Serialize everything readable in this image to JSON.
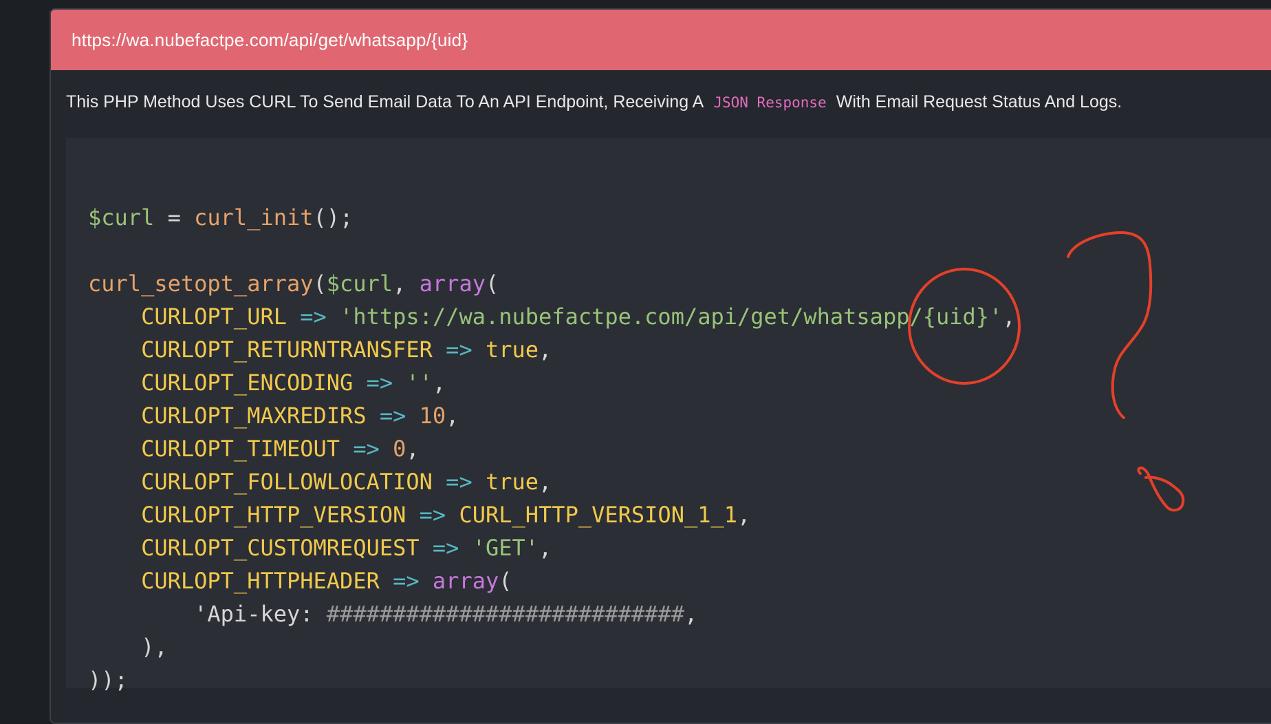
{
  "header": {
    "url": "https://wa.nubefactpe.com/api/get/whatsapp/{uid}"
  },
  "description": {
    "before": "This PHP Method Uses CURL To Send Email Data To An API Endpoint, Receiving A",
    "code": "JSON Response",
    "after": "With Email Request Status And Logs."
  },
  "code": {
    "line1_var": "$curl",
    "line1_eq": " = ",
    "line1_fn": "curl_init",
    "line1_end": "();",
    "line2_fn": "curl_setopt_array",
    "line2_open": "(",
    "line2_var": "$curl",
    "line2_comma": ", ",
    "line2_kw": "array",
    "line2_end": "(",
    "opts": [
      {
        "name": "CURLOPT_URL",
        "value": "'https://wa.nubefactpe.com/api/get/whatsapp/{uid}'",
        "type": "s"
      },
      {
        "name": "CURLOPT_RETURNTRANSFER",
        "value": "true",
        "type": "c"
      },
      {
        "name": "CURLOPT_ENCODING",
        "value": "''",
        "type": "s"
      },
      {
        "name": "CURLOPT_MAXREDIRS",
        "value": "10",
        "type": "n"
      },
      {
        "name": "CURLOPT_TIMEOUT",
        "value": "0",
        "type": "n"
      },
      {
        "name": "CURLOPT_FOLLOWLOCATION",
        "value": "true",
        "type": "c"
      },
      {
        "name": "CURLOPT_HTTP_VERSION",
        "value": "CURL_HTTP_VERSION_1_1",
        "type": "c"
      },
      {
        "name": "CURLOPT_CUSTOMREQUEST",
        "value": "'GET'",
        "type": "s"
      }
    ],
    "arrow": " => ",
    "header_name": "CURLOPT_HTTPHEADER",
    "header_kw": "array",
    "api_key_label": "'Api-key: ",
    "api_key_value": "###########################",
    "api_key_end": ",",
    "close_inner": "),",
    "close_outer": "));"
  },
  "annotation_colors": {
    "stroke": "#e3402b"
  }
}
